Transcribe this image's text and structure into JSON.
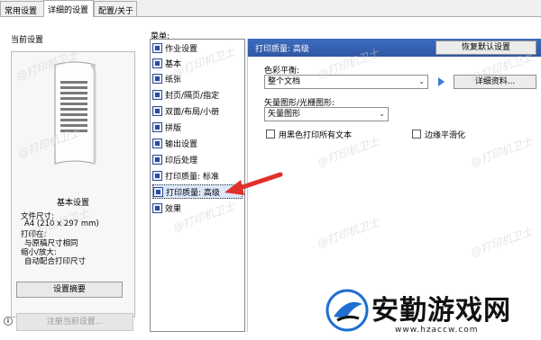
{
  "tabs": [
    "常用设置",
    "详细的设置",
    "配置/关于"
  ],
  "active_tab": 1,
  "left": {
    "section_title": "当前设置",
    "basic_title": "基本设置",
    "doc_size_label": "文件尺寸:",
    "doc_size_value": "A4 (210 x 297 mm)",
    "print_on_label": "打印在:",
    "print_on_value": "与原稿尺寸相同",
    "scale_label": "缩小/放大:",
    "scale_value": "自动配合打印尺寸",
    "summary_button": "设置摘要",
    "register_button": "注册当前设置..."
  },
  "menu": {
    "label": "菜单:",
    "items": [
      {
        "label": "作业设置",
        "icon": "job-settings-icon"
      },
      {
        "label": "基本",
        "icon": "basic-icon"
      },
      {
        "label": "纸张",
        "icon": "paper-icon"
      },
      {
        "label": "封页/隔页/指定",
        "icon": "cover-icon"
      },
      {
        "label": "双面/布局/小册",
        "icon": "duplex-icon"
      },
      {
        "label": "拼版",
        "icon": "imposition-icon"
      },
      {
        "label": "输出设置",
        "icon": "output-icon"
      },
      {
        "label": "印后处理",
        "icon": "finishing-icon"
      },
      {
        "label": "打印质量: 标准",
        "icon": "quality-standard-icon"
      },
      {
        "label": "打印质量: 高级",
        "icon": "quality-advanced-icon"
      },
      {
        "label": "效果",
        "icon": "effects-icon"
      }
    ],
    "selected_index": 9
  },
  "panel": {
    "title": "打印质量: 高级",
    "restore_button": "恢复默认设置",
    "color_balance_label": "色彩平衡:",
    "color_balance_value": "整个文档",
    "details_button": "详细资料...",
    "vector_label": "矢量图形/光栅图形:",
    "vector_value": "矢量图形",
    "black_text_label": "用黑色打印所有文本",
    "black_text_checked": false,
    "edge_smoothing_label": "边缘平滑化",
    "edge_smoothing_checked": false
  },
  "watermark": "@打印机卫士",
  "brand": {
    "name": "安勤游戏网",
    "url": "www.hzaccw.com"
  },
  "colors": {
    "header_blue": "#3a66b8",
    "selection": "#dbe8fb",
    "arrow_red": "#e0302a"
  }
}
